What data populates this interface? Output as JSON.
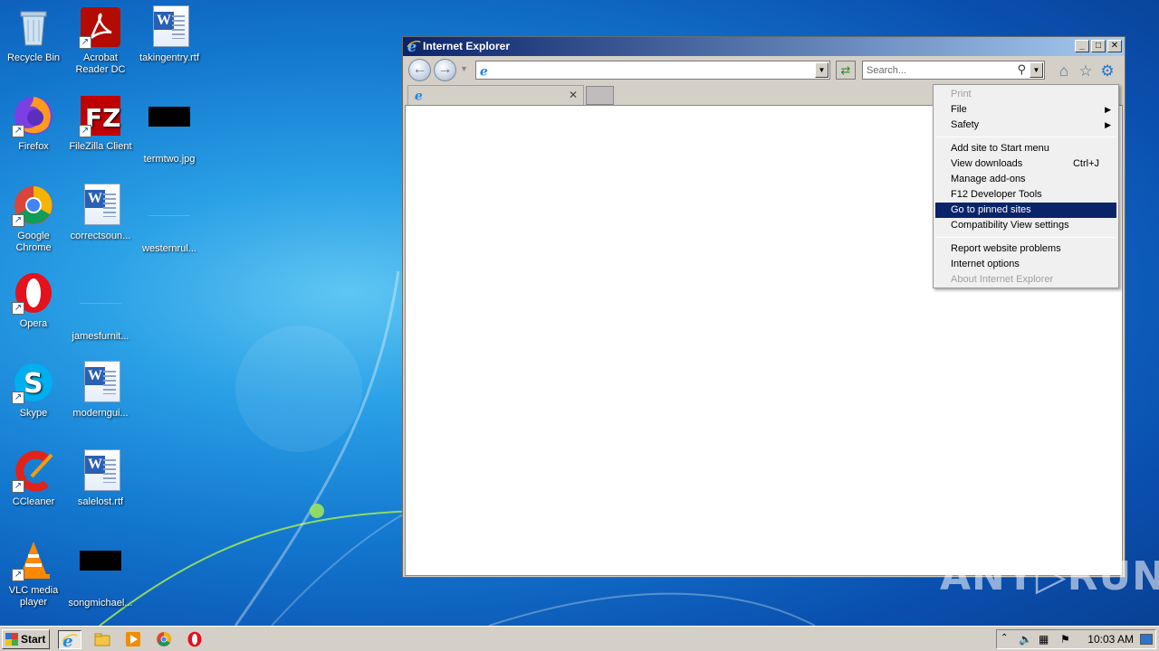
{
  "desktop": {
    "icons": [
      {
        "label": "Recycle Bin"
      },
      {
        "label": "Acrobat Reader DC"
      },
      {
        "label": "takingentry.rtf"
      },
      {
        "label": "Firefox"
      },
      {
        "label": "FileZilla Client"
      },
      {
        "label": "termtwo.jpg"
      },
      {
        "label": "Google Chrome"
      },
      {
        "label": "correctsoun..."
      },
      {
        "label": "westernrul..."
      },
      {
        "label": "Opera"
      },
      {
        "label": "jamesfurnit..."
      },
      {
        "label": "Skype"
      },
      {
        "label": "moderngui..."
      },
      {
        "label": "CCleaner"
      },
      {
        "label": "salelost.rtf"
      },
      {
        "label": "VLC media player"
      },
      {
        "label": "songmichael..."
      }
    ]
  },
  "ie": {
    "title": "Internet Explorer",
    "address_value": "",
    "search_placeholder": "Search...",
    "window_buttons": {
      "minimize": "_",
      "maximize": "□",
      "close": "✕"
    }
  },
  "tools_menu": {
    "items": [
      {
        "label": "Print",
        "state": "disabled"
      },
      {
        "label": "File",
        "submenu": true
      },
      {
        "label": "Safety",
        "submenu": true
      },
      {
        "label": "Add site to Start menu"
      },
      {
        "label": "View downloads",
        "shortcut": "Ctrl+J"
      },
      {
        "label": "Manage add-ons"
      },
      {
        "label": "F12 Developer Tools"
      },
      {
        "label": "Go to pinned sites",
        "state": "highlighted"
      },
      {
        "label": "Compatibility View settings"
      },
      {
        "label": "Report website problems"
      },
      {
        "label": "Internet options"
      },
      {
        "label": "About Internet Explorer",
        "state": "disabled"
      }
    ]
  },
  "watermark": "ANY▷RUN",
  "taskbar": {
    "start_label": "Start",
    "clock": "10:03 AM"
  },
  "colors": {
    "menu_highlight": "#0a246a",
    "title_gradient_start": "#0a246a",
    "title_gradient_end": "#a6caf0"
  }
}
